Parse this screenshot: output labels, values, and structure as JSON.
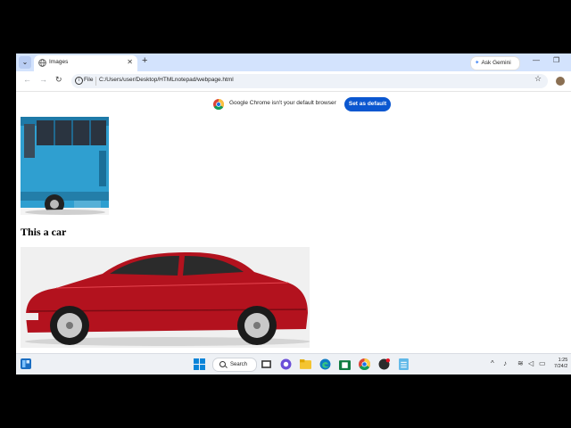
{
  "browser": {
    "tab": {
      "title": "Images"
    },
    "gemini_label": "Ask Gemini",
    "address": {
      "scheme_label": "File",
      "url": "C:/Users/user/Desktop/HTMLnotepad/webpage.html"
    },
    "infobar": {
      "message": "Google Chrome isn't your default browser",
      "button_label": "Set as default"
    }
  },
  "page": {
    "heading": "This a car"
  },
  "taskbar": {
    "search_label": "Search",
    "time": "1:25",
    "date": "7/24/2"
  },
  "colors": {
    "tabstrip": "#d3e3fd",
    "accent_button": "#0b57d0",
    "bus_body": "#2f9fd0",
    "car_body": "#b3121e"
  }
}
